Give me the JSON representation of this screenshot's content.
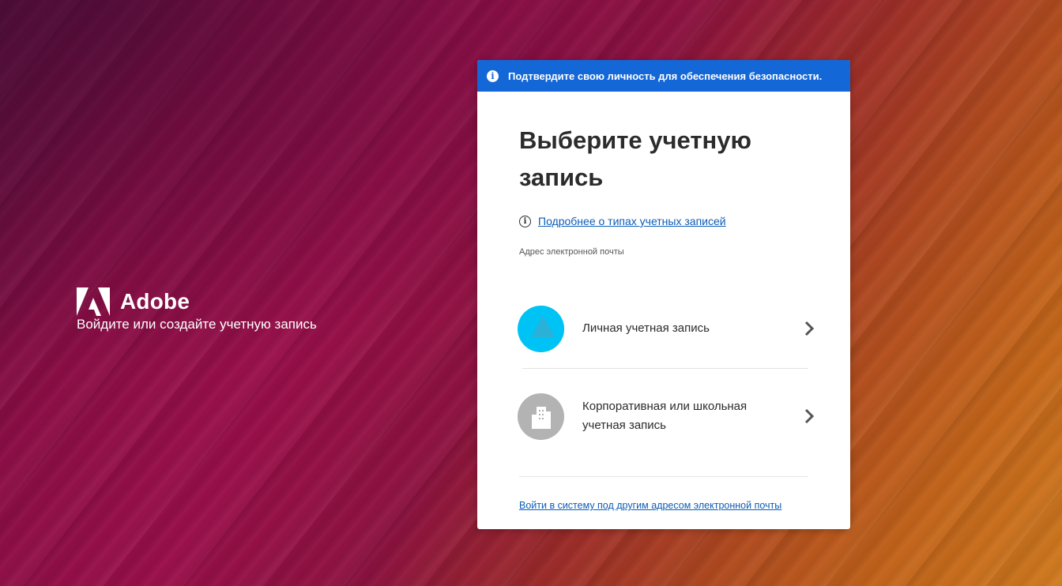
{
  "brand": {
    "name": "Adobe",
    "tagline": "Войдите или создайте учетную запись"
  },
  "banner": {
    "icon": "info-icon",
    "text": "Подтвердите свою личность для обеспечения безопасности."
  },
  "card": {
    "title": "Выберите учетную запись",
    "info_link": "Подробнее о типах учетных записей",
    "email_label": "Адрес электронной почты",
    "accounts": [
      {
        "label": "Личная учетная запись",
        "icon": "personal-account-icon"
      },
      {
        "label": "Корпоративная или школьная учетная запись",
        "icon": "building-icon"
      }
    ],
    "other_email_link": "Войти в систему под другим адресом электронной почты"
  },
  "colors": {
    "banner": "#1467d6",
    "link": "#0d5cb6",
    "personal_avatar": "#00c3f5",
    "business_avatar": "#b3b3b3"
  }
}
